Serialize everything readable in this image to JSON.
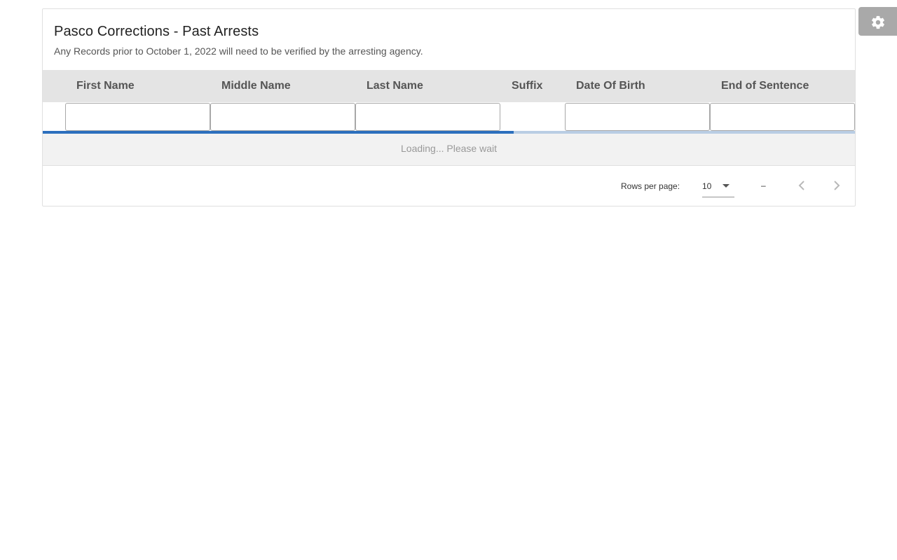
{
  "card": {
    "title": "Pasco Corrections - Past Arrests",
    "subtitle": "Any Records prior to October 1, 2022 will need to be verified by the arresting agency."
  },
  "table": {
    "columns": [
      {
        "label": "First Name",
        "filterable": true
      },
      {
        "label": "Middle Name",
        "filterable": true
      },
      {
        "label": "Last Name",
        "filterable": true
      },
      {
        "label": "Suffix",
        "filterable": false
      },
      {
        "label": "Date Of Birth",
        "filterable": true
      },
      {
        "label": "End of Sentence",
        "filterable": true
      }
    ],
    "filters": {
      "first_name": "",
      "middle_name": "",
      "last_name": "",
      "date_of_birth": "",
      "end_of_sentence": ""
    },
    "loading_progress_fraction": 0.58,
    "loading_text": "Loading... Please wait"
  },
  "pagination": {
    "rows_per_page_label": "Rows per page:",
    "rows_per_page_value": "10",
    "range_text": "–",
    "prev_icon": "chevron-left-icon",
    "next_icon": "chevron-right-icon"
  },
  "settings": {
    "icon": "gear-icon"
  },
  "colors": {
    "header_bg": "#e4e4e4",
    "progress_fill": "#2c6fbd",
    "progress_track": "#b9cde4",
    "loading_bg": "#f2f2f2",
    "settings_bg": "#a9a9a9"
  }
}
